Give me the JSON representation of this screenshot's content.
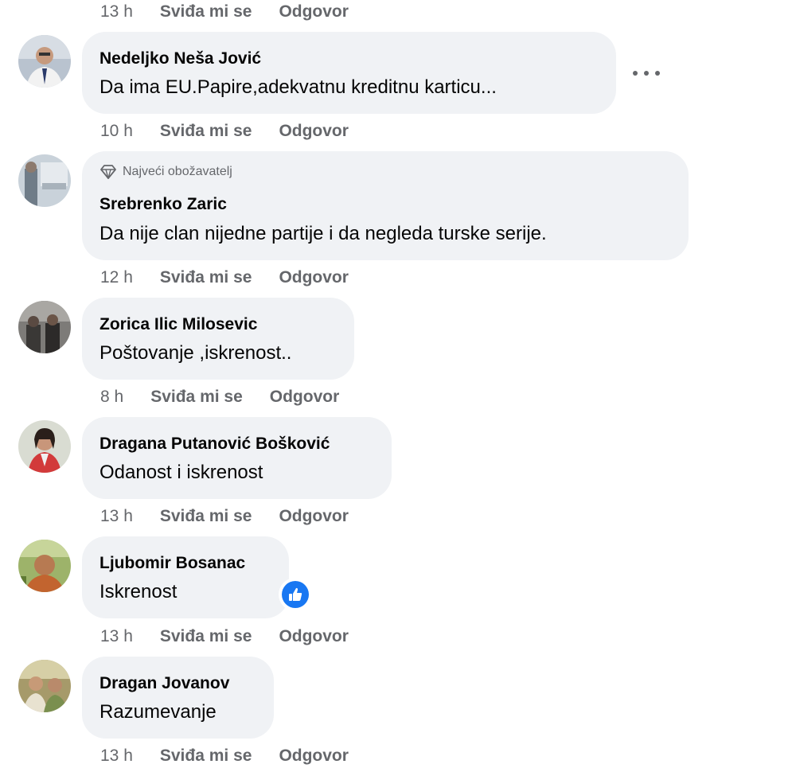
{
  "labels": {
    "like": "Sviđa mi se",
    "reply": "Odgovor"
  },
  "top_action": {
    "time": "13 h"
  },
  "comments": [
    {
      "author": "Nedeljko Neša Jović",
      "text": "Da ima EU.Papire,adekvatnu kreditnu karticu...",
      "time": "10 h"
    },
    {
      "badge": "Najveći obožavatelj",
      "author": "Srebrenko Zaric",
      "text": "Da nije clan nijedne partije i da negleda turske serije.",
      "time": "12 h"
    },
    {
      "author": "Zorica Ilic Milosevic",
      "text": "Poštovanje ,iskrenost..",
      "time": "8 h"
    },
    {
      "author": "Dragana Putanović Bošković",
      "text": "Odanost i iskrenost",
      "time": "13 h"
    },
    {
      "author": "Ljubomir Bosanac",
      "text": "Iskrenost",
      "time": "13 h"
    },
    {
      "author": "Dragan Jovanov",
      "text": "Razumevanje",
      "time": "13 h"
    }
  ],
  "icons": {
    "more": "more-options-icon",
    "badge": "diamond-icon",
    "reaction": "like-icon"
  },
  "colors": {
    "bubble": "#f0f2f5",
    "meta": "#65676b",
    "like_blue": "#1877f2"
  }
}
